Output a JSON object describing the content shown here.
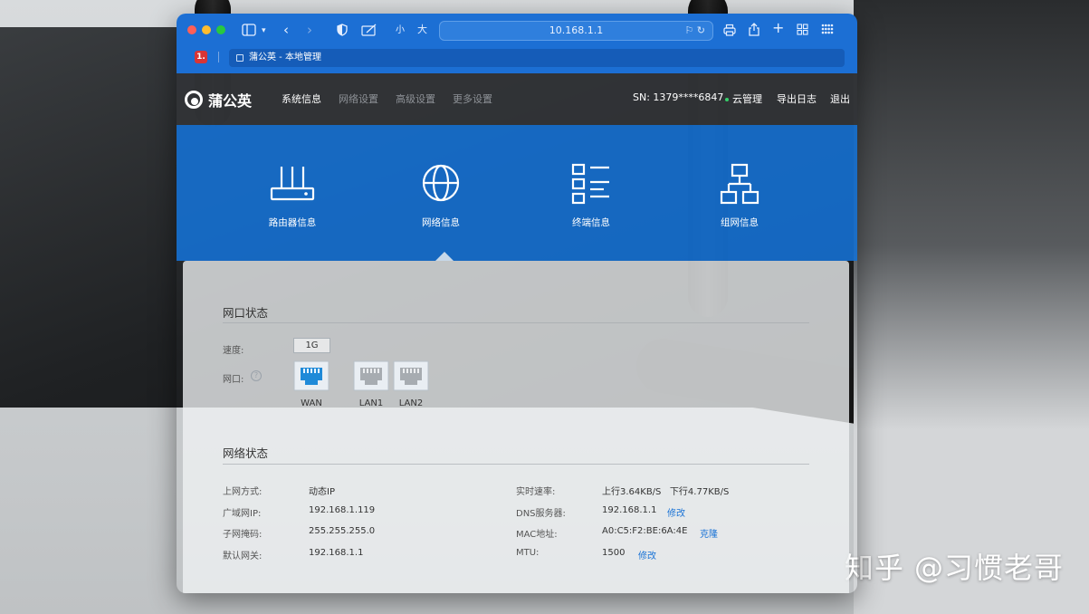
{
  "browser": {
    "url": "10.168.1.1",
    "text_size_small": "小",
    "text_size_large": "大",
    "pinned_tab_label": "1.",
    "active_tab_title": "蒲公英 - 本地管理"
  },
  "header": {
    "logo_text": "蒲公英",
    "nav": [
      {
        "label": "系统信息",
        "active": true
      },
      {
        "label": "网络设置",
        "active": false
      },
      {
        "label": "高级设置",
        "active": false
      },
      {
        "label": "更多设置",
        "active": false
      }
    ],
    "sn": "SN:  1379****6847",
    "cloud_label": "云管理",
    "export_log": "导出日志",
    "logout": "退出"
  },
  "hero": {
    "items": [
      {
        "label": "路由器信息",
        "icon": "router-icon"
      },
      {
        "label": "网络信息",
        "icon": "globe-icon",
        "selected": true
      },
      {
        "label": "终端信息",
        "icon": "list-icon"
      },
      {
        "label": "组网信息",
        "icon": "network-topology-icon"
      }
    ]
  },
  "port_status": {
    "title": "网口状态",
    "speed_label": "速度:",
    "speed_value": "1G",
    "port_label": "网口:",
    "help": "?",
    "ports": [
      {
        "name": "WAN",
        "active": true
      },
      {
        "name": "LAN1",
        "active": false
      },
      {
        "name": "LAN2",
        "active": false
      }
    ]
  },
  "network_status": {
    "title": "网络状态",
    "left": [
      {
        "label": "上网方式:",
        "value": "动态IP"
      },
      {
        "label": "广域网IP:",
        "value": "192.168.1.119"
      },
      {
        "label": "子网掩码:",
        "value": "255.255.255.0"
      },
      {
        "label": "默认网关:",
        "value": "192.168.1.1"
      }
    ],
    "right": [
      {
        "label": "实时速率:",
        "value": "上行3.64KB/S   下行4.77KB/S",
        "action": ""
      },
      {
        "label": "DNS服务器:",
        "value": "192.168.1.1",
        "action": "修改"
      },
      {
        "label": "MAC地址:",
        "value": "A0:C5:F2:BE:6A:4E",
        "action": "克隆"
      },
      {
        "label": "MTU:",
        "value": "1500",
        "action": "修改"
      }
    ]
  },
  "watermark": "知乎 @习惯老哥",
  "colors": {
    "toolbar_blue": "#1c6fd4",
    "hero_blue": "#1570d2",
    "navbar_dark": "#323437",
    "link_blue": "#1a73d6",
    "port_active": "#1f8ad8"
  }
}
